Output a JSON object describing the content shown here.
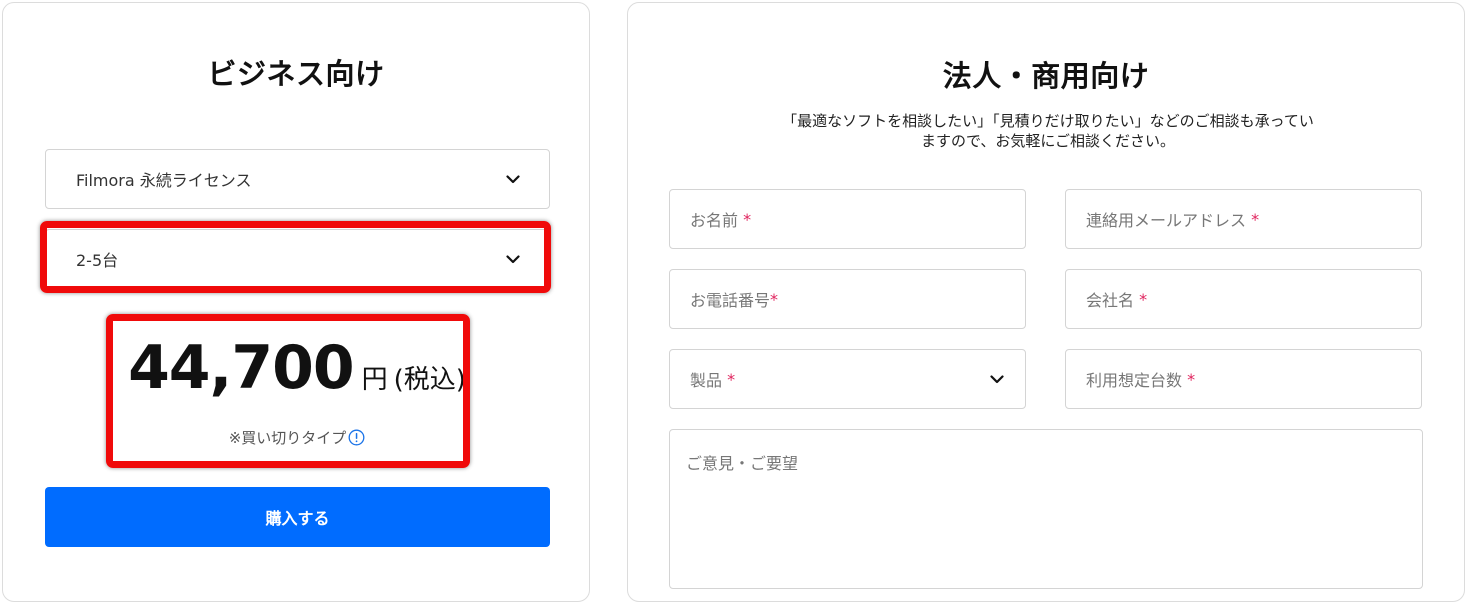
{
  "business": {
    "title": "ビジネス向け",
    "product_select": {
      "value": "Filmora 永続ライセンス"
    },
    "quantity_select": {
      "value": "2-5台"
    },
    "price": {
      "amount": "44,700",
      "unit": "円",
      "tax_note": "(税込)",
      "type_note": "※買い切りタイプ"
    },
    "buy_button_label": "購入する"
  },
  "corporate": {
    "title": "法人・商用向け",
    "description_line1": "「最適なソフトを相談したい」「見積りだけ取りたい」などのご相談も承ってい",
    "description_line2": "ますので、お気軽にご相談ください。",
    "fields": {
      "name": {
        "placeholder": "お名前",
        "required_mark": "*"
      },
      "email": {
        "placeholder": "連絡用メールアドレス",
        "required_mark": "*"
      },
      "phone": {
        "placeholder": "お電話番号",
        "required_mark": "*"
      },
      "company": {
        "placeholder": "会社名",
        "required_mark": "*"
      },
      "product": {
        "placeholder": "製品",
        "required_mark": "*"
      },
      "seats": {
        "placeholder": "利用想定台数",
        "required_mark": "*"
      },
      "comments": {
        "placeholder": "ご意見・ご要望"
      }
    }
  },
  "colors": {
    "accent": "#006cff",
    "highlight": "#f00a0a",
    "required": "#e0245e"
  },
  "icons": {
    "select_arrow": "chevron-down-icon",
    "info": "info-circle-icon"
  }
}
